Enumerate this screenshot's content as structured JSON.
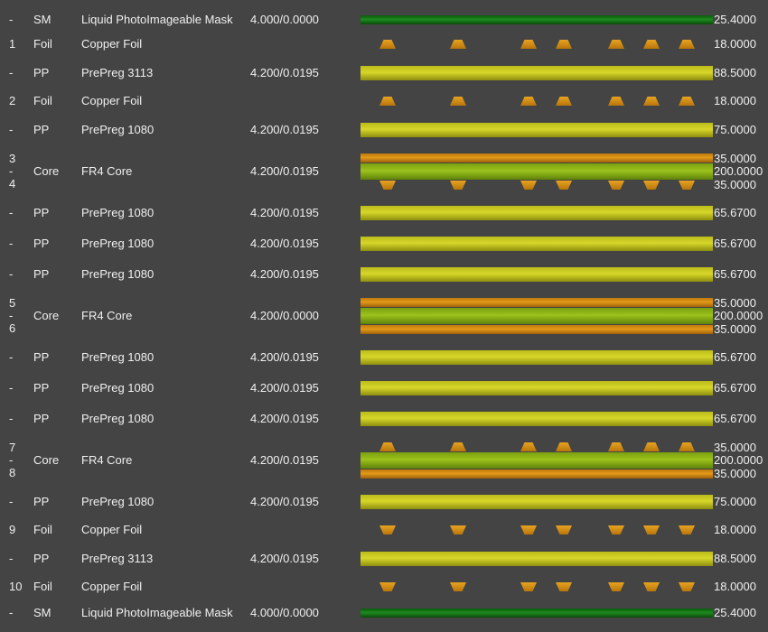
{
  "rows": [
    {
      "layer": "-",
      "type": "SM",
      "material": "Liquid PhotoImageable Mask",
      "dk": "4.000/0.0000",
      "labels": [
        "25.4000"
      ]
    },
    {
      "layer": "1",
      "type": "Foil",
      "material": "Copper Foil",
      "dk": "",
      "labels": [
        "18.0000"
      ]
    },
    {
      "layer": "-",
      "type": "PP",
      "material": "PrePreg 3113",
      "dk": "4.200/0.0195",
      "labels": [
        "88.5000"
      ]
    },
    {
      "layer": "2",
      "type": "Foil",
      "material": "Copper Foil",
      "dk": "",
      "labels": [
        "18.0000"
      ]
    },
    {
      "layer": "-",
      "type": "PP",
      "material": "PrePreg 1080",
      "dk": "4.200/0.0195",
      "labels": [
        "75.0000"
      ]
    },
    {
      "layer": "3\n-\n4",
      "type": "Core",
      "material": "FR4 Core",
      "dk": "4.200/0.0195",
      "labels": [
        "35.0000",
        "200.0000",
        "35.0000"
      ]
    },
    {
      "layer": "-",
      "type": "PP",
      "material": "PrePreg 1080",
      "dk": "4.200/0.0195",
      "labels": [
        "65.6700"
      ]
    },
    {
      "layer": "-",
      "type": "PP",
      "material": "PrePreg 1080",
      "dk": "4.200/0.0195",
      "labels": [
        "65.6700"
      ]
    },
    {
      "layer": "-",
      "type": "PP",
      "material": "PrePreg 1080",
      "dk": "4.200/0.0195",
      "labels": [
        "65.6700"
      ]
    },
    {
      "layer": "5\n-\n6",
      "type": "Core",
      "material": "FR4 Core",
      "dk": "4.200/0.0000",
      "labels": [
        "35.0000",
        "200.0000",
        "35.0000"
      ]
    },
    {
      "layer": "-",
      "type": "PP",
      "material": "PrePreg 1080",
      "dk": "4.200/0.0195",
      "labels": [
        "65.6700"
      ]
    },
    {
      "layer": "-",
      "type": "PP",
      "material": "PrePreg 1080",
      "dk": "4.200/0.0195",
      "labels": [
        "65.6700"
      ]
    },
    {
      "layer": "-",
      "type": "PP",
      "material": "PrePreg 1080",
      "dk": "4.200/0.0195",
      "labels": [
        "65.6700"
      ]
    },
    {
      "layer": "7\n-\n8",
      "type": "Core",
      "material": "FR4 Core",
      "dk": "4.200/0.0195",
      "labels": [
        "35.0000",
        "200.0000",
        "35.0000"
      ]
    },
    {
      "layer": "-",
      "type": "PP",
      "material": "PrePreg 1080",
      "dk": "4.200/0.0195",
      "labels": [
        "75.0000"
      ]
    },
    {
      "layer": "9",
      "type": "Foil",
      "material": "Copper Foil",
      "dk": "",
      "labels": [
        "18.0000"
      ]
    },
    {
      "layer": "-",
      "type": "PP",
      "material": "PrePreg 3113",
      "dk": "4.200/0.0195",
      "labels": [
        "88.5000"
      ]
    },
    {
      "layer": "10",
      "type": "Foil",
      "material": "Copper Foil",
      "dk": "",
      "labels": [
        "18.0000"
      ]
    },
    {
      "layer": "-",
      "type": "SM",
      "material": "Liquid PhotoImageable Mask",
      "dk": "4.000/0.0000",
      "labels": [
        "25.4000"
      ]
    }
  ],
  "colors": {
    "background": "#444444",
    "solder_mask": "#1f8a1f",
    "prepreg": "#d6d62a",
    "copper": "#e29a1a",
    "core": "#9cc21c"
  },
  "icon_names": [
    "copper-trace-icon"
  ]
}
